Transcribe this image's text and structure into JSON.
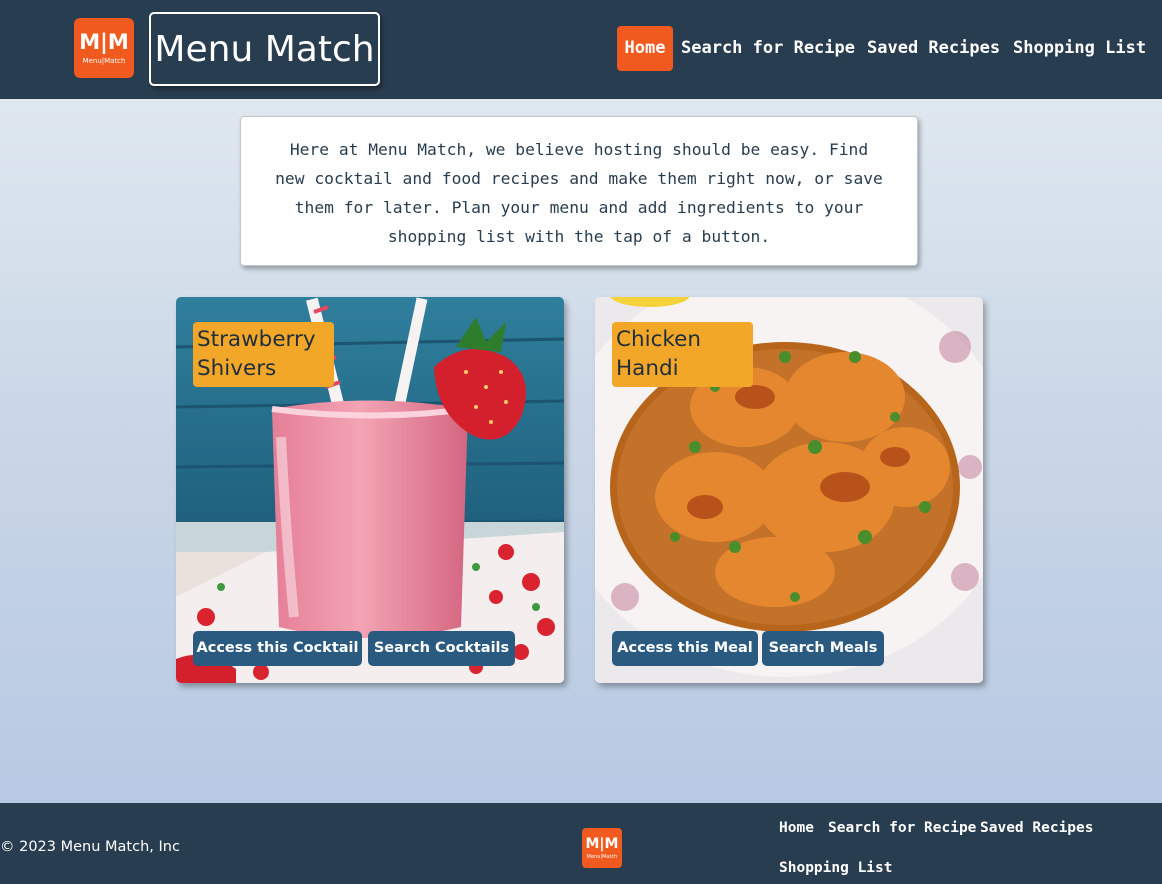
{
  "header": {
    "logo_mark": "M|M",
    "logo_sub": "Menu|Match",
    "brand_title": "Menu Match",
    "nav": [
      {
        "label": "Home",
        "active": true
      },
      {
        "label": "Search for Recipe"
      },
      {
        "label": "Saved Recipes"
      },
      {
        "label": "Shopping List"
      }
    ]
  },
  "intro": {
    "text": "Here at Menu Match, we believe hosting should be easy. Find new cocktail and food recipes and make them right now, or save them for later. Plan your menu and add ingredients to your shopping list with the tap of a button."
  },
  "cards": [
    {
      "title": "Strawberry Shivers",
      "primary_button": "Access this Cocktail",
      "secondary_button": "Search Cocktails",
      "image": "strawberry-smoothie-photo"
    },
    {
      "title": "Chicken Handi",
      "primary_button": "Access this Meal",
      "secondary_button": "Search Meals",
      "image": "chicken-curry-photo"
    }
  ],
  "footer": {
    "copyright": "© 2023 Menu Match, Inc",
    "logo_mark": "M|M",
    "logo_sub": "Menu|Match",
    "nav": [
      {
        "label": "Home"
      },
      {
        "label": "Search for Recipe"
      },
      {
        "label": "Saved Recipes"
      },
      {
        "label": "Shopping List"
      }
    ]
  },
  "colors": {
    "header_bg": "#283d4f",
    "accent_orange": "#f05a1e",
    "title_badge": "#f3a729",
    "button_blue": "#2b5a80"
  }
}
